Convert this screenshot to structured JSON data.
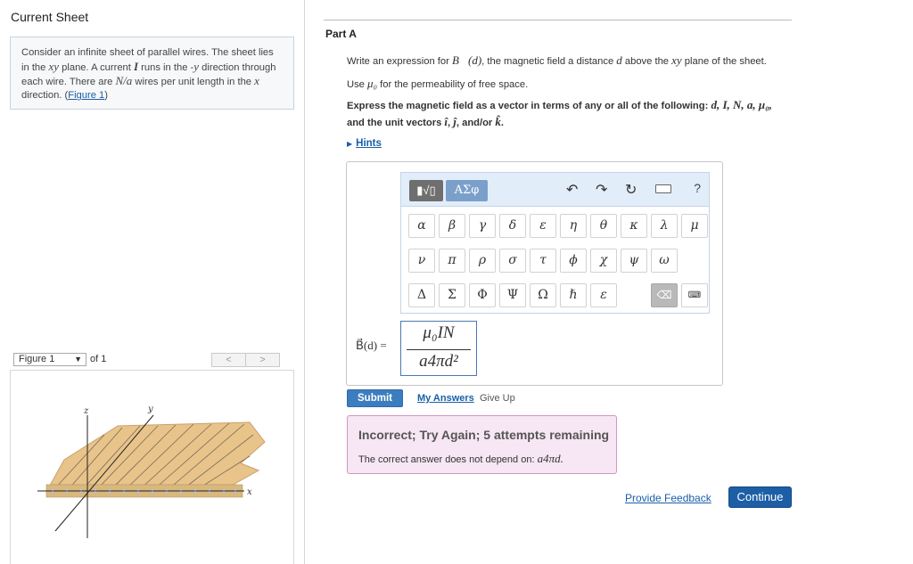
{
  "left_panel": {
    "title": "Current Sheet",
    "problem": {
      "t1": "Consider an infinite sheet of parallel wires. The sheet lies in the ",
      "xy": "xy",
      "t2": " plane. A current ",
      "I": "I",
      "t3": " runs in the -",
      "y": "y",
      "t4": " direction through each wire. There are ",
      "Na": "N/a",
      "t5": " wires per unit length in the ",
      "x": "x",
      "t6": " direction. (",
      "figure_link": "Figure 1",
      "t7": ")"
    },
    "figure_nav": {
      "select_value": "Figure 1",
      "of_text": "of 1",
      "prev": "<",
      "next": ">"
    },
    "figure_labels": {
      "z": "z",
      "y": "y",
      "x": "x"
    }
  },
  "part": {
    "title": "Part A",
    "q1": {
      "a": "Write an expression for ",
      "Bd": "B⃗(d)",
      "b": ", the magnetic field a distance ",
      "d": "d",
      "c": " above the ",
      "xy": "xy",
      "e": " plane of the sheet."
    },
    "q2": {
      "a": "Use ",
      "mu0": "μ₀",
      "b": " for the permeability of free space."
    },
    "q3": {
      "a": "Express the magnetic field as a vector in terms of any or all of the following: ",
      "vars": "d, I, N, a, μ₀,",
      "b": "and the unit vectors ",
      "i": "î",
      "c": ", ",
      "j": "ĵ",
      "d": ", and/or ",
      "k": "k̂",
      "e": "."
    },
    "hints": "Hints"
  },
  "toolbar": {
    "template_label": "▮√▯",
    "greek_label": "AΣφ",
    "undo": "↶",
    "redo": "↷",
    "reset": "↻",
    "help": "?",
    "row1": [
      "α",
      "β",
      "γ",
      "δ",
      "ε",
      "η",
      "θ",
      "κ",
      "λ",
      "μ"
    ],
    "row2": [
      "ν",
      "π",
      "ρ",
      "σ",
      "τ",
      "ϕ",
      "χ",
      "ψ",
      "ω"
    ],
    "row3": [
      "Δ",
      "Σ",
      "Φ",
      "Ψ",
      "Ω",
      "ℏ",
      "ɛ"
    ],
    "delete": "⌫",
    "keyboard": "⌨"
  },
  "equation": {
    "label": "B⃗(d) =",
    "numerator": "μ₀IN",
    "denominator": "a4πd²"
  },
  "actions": {
    "submit": "Submit",
    "my_answers": "My Answers",
    "give_up": "Give Up"
  },
  "feedback": {
    "title": "Incorrect; Try Again; 5 attempts remaining",
    "text": "The correct answer does not depend on: ",
    "term": "a4πd."
  },
  "footer": {
    "provide_feedback": "Provide Feedback",
    "continue": "Continue"
  },
  "colors": {
    "accent": "#3b7dbf",
    "continue": "#1d5fa6",
    "feedback_bg": "#f7e6f3",
    "sheet_fill": "#e8c48b"
  }
}
